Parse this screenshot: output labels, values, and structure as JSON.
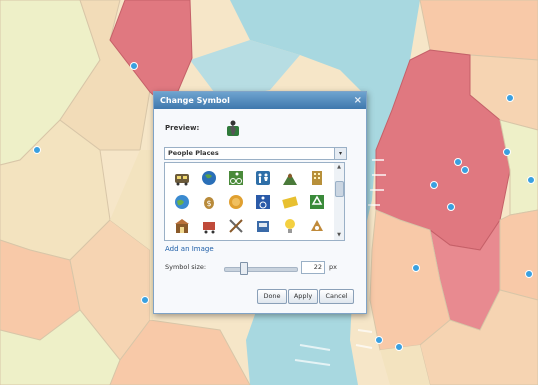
{
  "dialog": {
    "title": "Change Symbol",
    "close_glyph": "×",
    "preview_label": "Preview:",
    "symbol_set": "People Places",
    "dropdown_arrow": "▾",
    "add_image_link": "Add an Image",
    "size_label": "Symbol size:",
    "size_value": "22",
    "size_unit": "px",
    "buttons": {
      "done": "Done",
      "apply": "Apply",
      "cancel": "Cancel"
    },
    "symbols": [
      "bus-stop-icon",
      "globe-icon",
      "cyclist-icon",
      "restroom-icon",
      "hiking-icon",
      "building-icon",
      "world-icon",
      "money-icon",
      "coins-icon",
      "wheelchair-icon",
      "ticket-icon",
      "recycle-icon",
      "store-icon",
      "cart-icon",
      "tools-icon",
      "hardware-icon",
      "lightbulb-icon",
      "attraction-icon"
    ]
  },
  "map": {
    "colors": {
      "water": "#a8d8e0",
      "residential": "#f8c9a8",
      "park": "#eef0c8",
      "highlight": "#e07880",
      "poi": "#3aa0e0"
    }
  }
}
